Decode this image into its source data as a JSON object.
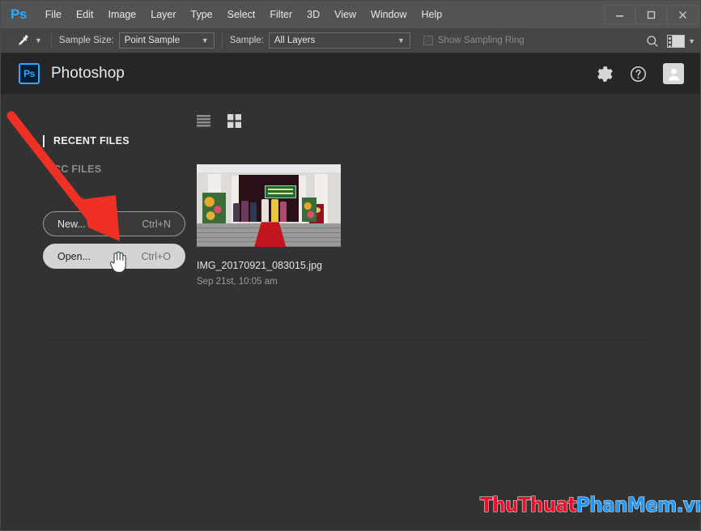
{
  "window": {
    "app_logo": "Ps",
    "controls": {
      "minimize": "minimize-button",
      "maximize": "maximize-button",
      "close": "close-button"
    }
  },
  "menubar": {
    "items": [
      {
        "label": "File"
      },
      {
        "label": "Edit"
      },
      {
        "label": "Image"
      },
      {
        "label": "Layer"
      },
      {
        "label": "Type"
      },
      {
        "label": "Select"
      },
      {
        "label": "Filter"
      },
      {
        "label": "3D"
      },
      {
        "label": "View"
      },
      {
        "label": "Window"
      },
      {
        "label": "Help"
      }
    ]
  },
  "options_bar": {
    "tool_icon": "eyedropper-icon",
    "tool_preset_chevron": "chevron-down-icon",
    "sample_size_label": "Sample Size:",
    "sample_size_value": "Point Sample",
    "sample_label": "Sample:",
    "sample_value": "All Layers",
    "show_sampling_ring_label": "Show Sampling Ring",
    "show_sampling_ring_checked": false,
    "search_icon": "search-icon",
    "workspace_icon": "workspace-switcher-icon",
    "workspace_chevron": "chevron-down-icon"
  },
  "start_header": {
    "badge": "Ps",
    "title": "Photoshop",
    "icons": [
      {
        "name": "gear-icon"
      },
      {
        "name": "help-icon"
      },
      {
        "name": "user-avatar-icon"
      }
    ]
  },
  "start_screen": {
    "view_toggles": [
      {
        "name": "list-view-icon",
        "selected": false
      },
      {
        "name": "grid-view-icon",
        "selected": true
      }
    ],
    "nav": {
      "recent_files": "RECENT FILES",
      "cc_files": "CC FILES"
    },
    "buttons": [
      {
        "label": "New...",
        "shortcut": "Ctrl+N"
      },
      {
        "label": "Open...",
        "shortcut": "Ctrl+O"
      }
    ],
    "recent_file": {
      "name": "IMG_20170921_083015.jpg",
      "date": "Sep 21st, 10:05 am"
    }
  },
  "annotation": {
    "arrow_color": "#ee3124"
  },
  "watermark": {
    "part1": "ThuThuat",
    "part2": "PhanMem.vn",
    "color1": "#e8112d",
    "color2": "#2196f3"
  },
  "theme": {
    "menubar_bg": "#535353",
    "options_bg": "#454545",
    "header_bg": "#262626",
    "body_bg": "#323232",
    "accent_blue": "#31a8ff"
  }
}
